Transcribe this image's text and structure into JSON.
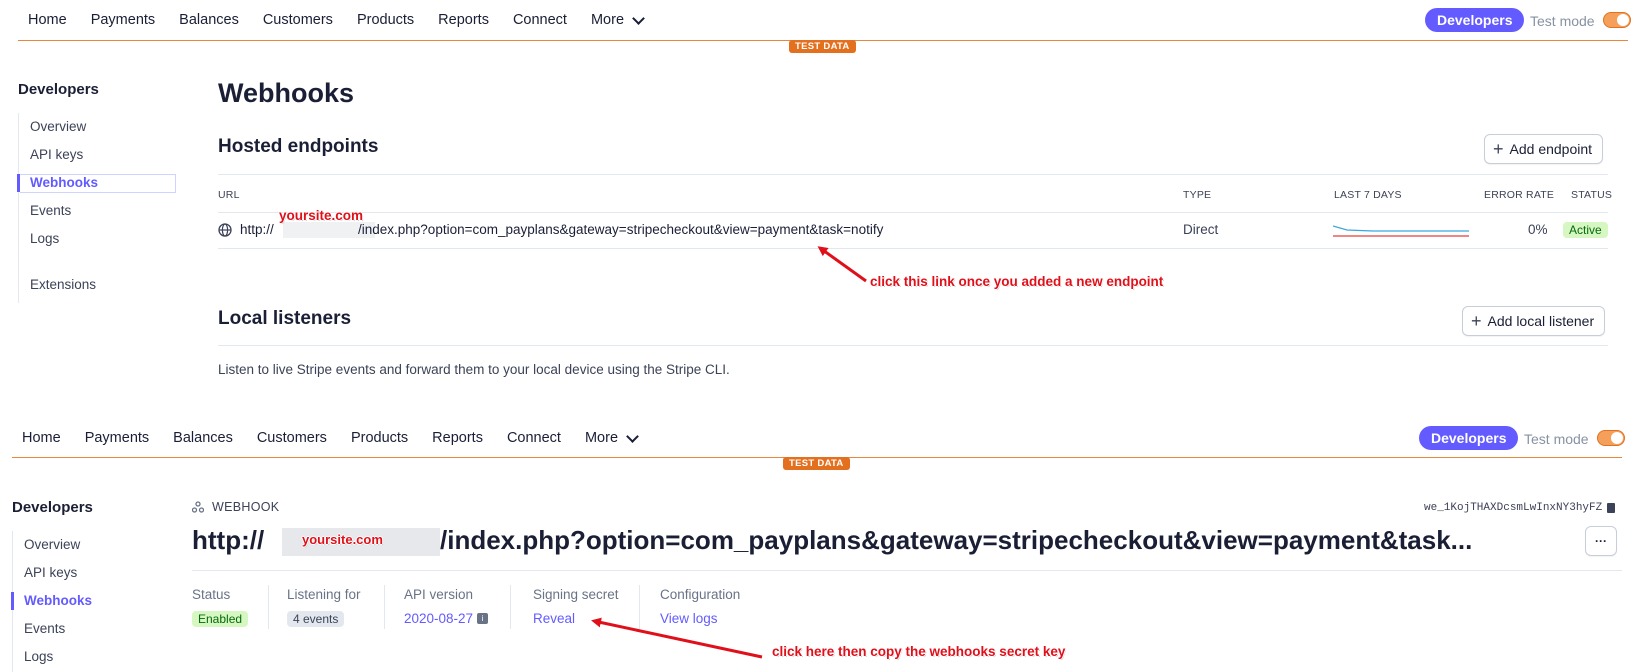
{
  "nav": {
    "items": [
      "Home",
      "Payments",
      "Balances",
      "Customers",
      "Products",
      "Reports",
      "Connect"
    ],
    "more": "More",
    "developers": "Developers",
    "test_mode": "Test mode",
    "test_badge": "TEST DATA"
  },
  "sidebar": {
    "title": "Developers",
    "items": [
      "Overview",
      "API keys",
      "Webhooks",
      "Events",
      "Logs"
    ],
    "active": "Webhooks",
    "extensions": "Extensions"
  },
  "webhooks_page": {
    "title": "Webhooks",
    "hosted_title": "Hosted endpoints",
    "add_endpoint": "Add endpoint",
    "columns": {
      "url": "URL",
      "type": "TYPE",
      "last7": "LAST 7 DAYS",
      "error_rate": "ERROR RATE",
      "status": "STATUS"
    },
    "endpoint": {
      "url_prefix": "http://",
      "url_suffix": "/index.php?option=com_payplans&gateway=stripecheckout&view=payment&task=notify",
      "type": "Direct",
      "error_rate": "0%",
      "status": "Active"
    },
    "local_title": "Local listeners",
    "add_local": "Add local listener",
    "local_desc": "Listen to live Stripe events and forward them to your local device using the Stripe CLI."
  },
  "annotations": {
    "yoursite_1": "yoursite.com",
    "yoursite_2": "yoursite.com",
    "note_1": "click this link once you added a new endpoint",
    "note_2": "click here then copy the webhooks secret key"
  },
  "webhook_detail": {
    "label": "WEBHOOK",
    "id": "we_1KojTHAXDcsmLwInxNY3hyFZ",
    "url_prefix": "http://",
    "url_suffix": "/index.php?option=com_payplans&gateway=stripecheckout&view=payment&task...",
    "more_button": "···",
    "status_label": "Status",
    "status_value": "Enabled",
    "listening_label": "Listening for",
    "listening_value": "4 events",
    "api_label": "API version",
    "api_value": "2020-08-27",
    "signing_label": "Signing secret",
    "signing_value": "Reveal",
    "config_label": "Configuration",
    "config_value": "View logs"
  },
  "colors": {
    "accent": "#635bff",
    "test_orange": "#e3701f",
    "active_green_bg": "#d7f7c2",
    "active_green_text": "#05690d",
    "annotation_red": "#e0101a"
  },
  "icons": [
    "chevron-down-icon",
    "globe-icon",
    "plus-icon",
    "webhook-icon",
    "info-icon",
    "copy-icon",
    "arrow-icon"
  ]
}
